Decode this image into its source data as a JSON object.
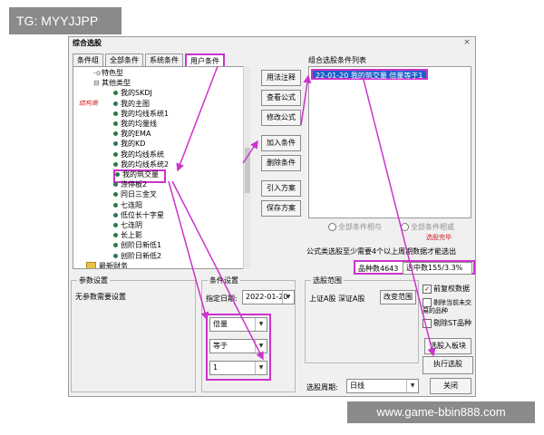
{
  "watermark_top": "TG: MYYJJPP",
  "watermark_bottom": "www.game-bbin888.com",
  "window": {
    "title": "综合选股",
    "close_glyph": "×"
  },
  "tabs": [
    {
      "label": "条件组"
    },
    {
      "label": "全部条件"
    },
    {
      "label": "系统条件"
    },
    {
      "label": "用户条件"
    }
  ],
  "tree": {
    "nodes": [
      {
        "label": "特色型",
        "kind": "branch",
        "twist": "-o"
      },
      {
        "label": "其他类型",
        "kind": "branch",
        "twist": "⊟"
      },
      {
        "label": "我的SKDJ",
        "kind": "leaf"
      },
      {
        "label": "我的主图",
        "kind": "leaf"
      },
      {
        "label": "我的均线系统1",
        "kind": "leaf"
      },
      {
        "label": "我的均量线",
        "kind": "leaf"
      },
      {
        "label": "我的EMA",
        "kind": "leaf"
      },
      {
        "label": "我的KD",
        "kind": "leaf"
      },
      {
        "label": "我的均线系统",
        "kind": "leaf"
      },
      {
        "label": "我的均线系统2",
        "kind": "leaf"
      },
      {
        "label": "我的筑交量",
        "kind": "leaf"
      },
      {
        "label": "涤停板2",
        "kind": "leaf"
      },
      {
        "label": "同日三金叉",
        "kind": "leaf"
      },
      {
        "label": "七连阳",
        "kind": "leaf"
      },
      {
        "label": "低位长十字星",
        "kind": "leaf"
      },
      {
        "label": "七连阴",
        "kind": "leaf"
      },
      {
        "label": "长上影",
        "kind": "leaf"
      },
      {
        "label": "创阶日新低1",
        "kind": "leaf"
      },
      {
        "label": "创阶日新低2",
        "kind": "leaf"
      },
      {
        "label": "最新财务",
        "kind": "folder"
      }
    ],
    "red_note": "结构高"
  },
  "buttons": {
    "usage": "用法注释",
    "view_formula": "查看公式",
    "modify_formula": "修改公式",
    "add_condition": "加入条件",
    "delete_condition": "删除条件",
    "import_plan": "引入方案",
    "save_plan": "保存方案",
    "add_to_block": "选股入板块",
    "execute": "执行选股",
    "close": "关闭",
    "change_range": "改变范围"
  },
  "condition_list": {
    "title": "组合选股条件列表",
    "items": [
      "22-01-20 我的筑交量 倍量等于1"
    ]
  },
  "logic": {
    "all_and": "全部条件相与",
    "all_or": "全部条件相或",
    "hint": "选股完毕"
  },
  "notice": "公式类选股至少需要4个以上周期数据才能选出",
  "stats": {
    "total": "品种数4643",
    "selected": "选中数155/3.3%"
  },
  "params": {
    "title": "参数设置",
    "text": "无参数需要设置"
  },
  "condition_setup": {
    "title": "条件设置",
    "date_label": "指定日期:",
    "date_value": "2022-01-20",
    "combo1": "倍量",
    "combo2": "等于",
    "combo3": "1"
  },
  "range": {
    "title": "选股范围",
    "text": "上证A股 深证A股",
    "checks": [
      {
        "label": "前复权数据",
        "checked": true
      },
      {
        "label": "剔除当前未交易的品种",
        "checked": false
      },
      {
        "label": "剔除ST品种",
        "checked": false
      }
    ]
  },
  "period": {
    "label": "选股周期:",
    "value": "日线"
  },
  "highlight_color": "#cc33cc"
}
